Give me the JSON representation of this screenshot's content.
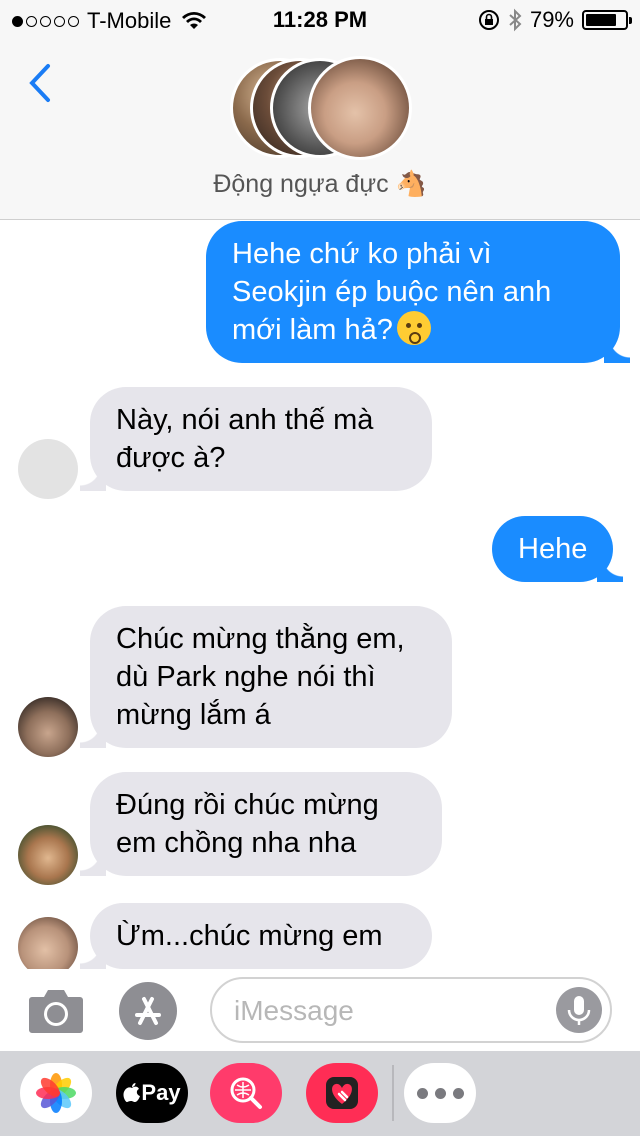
{
  "status_bar": {
    "carrier": "T-Mobile",
    "time": "11:28 PM",
    "battery_percent": "79%",
    "battery_level": 0.79,
    "signal_bars_filled": 1,
    "signal_bars_total": 5,
    "icons": [
      "wifi-icon",
      "rotation-lock-icon",
      "bluetooth-icon",
      "battery-icon"
    ]
  },
  "header": {
    "back_icon": "chevron-left-icon",
    "contact_name": "Động ngựa đực 🐴",
    "group_avatars": 4
  },
  "messages": [
    {
      "direction": "outgoing",
      "text": "Hehe chứ ko phải vì Seokjin ép buộc nên anh mới làm hả?",
      "emoji": "kissing-face-icon"
    },
    {
      "direction": "incoming",
      "text": "Này, nói anh thế mà được à?",
      "avatar": "empty"
    },
    {
      "direction": "outgoing",
      "text": "Hehe"
    },
    {
      "direction": "incoming",
      "text": "Chúc mừng thằng em, dù Park nghe nói thì mừng lắm á",
      "avatar": "photo"
    },
    {
      "direction": "incoming",
      "text": "Đúng rồi chúc mừng em chồng nha nha",
      "avatar": "photo"
    },
    {
      "direction": "incoming",
      "text": "Ừm...chúc mừng em",
      "avatar": "photo"
    }
  ],
  "compose": {
    "placeholder": "iMessage",
    "camera_icon": "camera-icon",
    "appstore_icon": "app-store-icon",
    "mic_icon": "microphone-icon"
  },
  "app_drawer": {
    "apple_pay_label": "Pay",
    "apps": [
      "photos-icon",
      "apple-pay-icon",
      "search-images-icon",
      "digital-touch-icon",
      "more-icon"
    ]
  }
}
